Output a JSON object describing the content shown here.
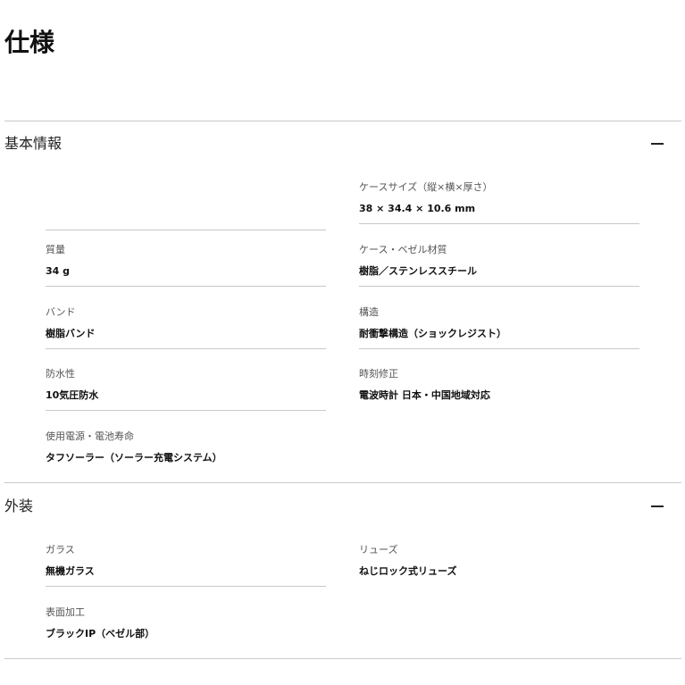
{
  "page_title": "仕様",
  "sections": [
    {
      "title": "基本情報",
      "toggle_icon": "minus-icon",
      "items": [
        {
          "label": "ケースサイズ（縦×横×厚さ）",
          "value": "38 × 34.4 × 10.6 mm"
        },
        {
          "label": "質量",
          "value": "34 g"
        },
        {
          "label": "ケース・ベゼル材質",
          "value": "樹脂／ステンレススチール"
        },
        {
          "label": "バンド",
          "value": "樹脂バンド"
        },
        {
          "label": "構造",
          "value": "耐衝撃構造（ショックレジスト）"
        },
        {
          "label": "防水性",
          "value": "10気圧防水"
        },
        {
          "label": "時刻修正",
          "value": "電波時計 日本・中国地域対応"
        },
        {
          "label": "使用電源・電池寿命",
          "value": "タフソーラー（ソーラー充電システム）"
        }
      ]
    },
    {
      "title": "外装",
      "toggle_icon": "minus-icon",
      "items": [
        {
          "label": "ガラス",
          "value": "無機ガラス"
        },
        {
          "label": "リューズ",
          "value": "ねじロック式リューズ"
        },
        {
          "label": "表面加工",
          "value": "ブラックIP（ベゼル部）"
        }
      ]
    }
  ]
}
